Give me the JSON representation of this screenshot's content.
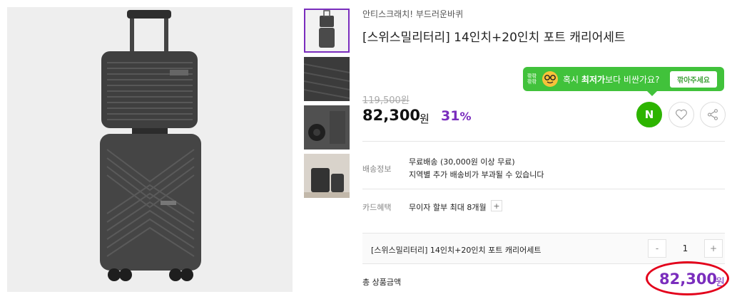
{
  "product": {
    "brand": "안티스크래치! 부드러운바퀴",
    "title": "[스위스밀리터리] 14인치+20인치 포트 캐리어세트",
    "images": {
      "main": "luggage-set-main",
      "thumbnails": [
        "luggage-set-front",
        "luggage-shell-closeup",
        "luggage-wheel-closeup",
        "luggage-lifestyle"
      ]
    }
  },
  "tooltip": {
    "logo_text": "깎깎깎깎",
    "message_pre": "혹시 ",
    "message_bold": "최저가",
    "message_post": "보다 비싼가요?",
    "button_label": "깎아주세요"
  },
  "price": {
    "original": "119,500",
    "original_unit": "원",
    "sale": "82,300",
    "sale_unit": "원",
    "discount": "31",
    "discount_unit": "%"
  },
  "actions": {
    "naver_label": "N",
    "naver_color": "#2db400",
    "wish_icon": "heart-icon",
    "share_icon": "share-icon"
  },
  "shipping": {
    "label": "배송정보",
    "line1": "무료배송 (30,000원 이상 무료)",
    "line2": "지역별 추가 배송비가 부과될 수 있습니다"
  },
  "card": {
    "label": "카드혜택",
    "text": "무이자 할부 최대 8개월",
    "plus": "+"
  },
  "option": {
    "name": "[스위스밀리터리] 14인치+20인치 포트 캐리어세트",
    "minus": "-",
    "quantity": "1",
    "plus": "+"
  },
  "total": {
    "label": "총 상품금액",
    "amount": "82,300",
    "unit": "원"
  },
  "colors": {
    "accent": "#7a2dbd",
    "tooltip_bg": "#41c23b",
    "highlight_ring": "#e3001b"
  }
}
